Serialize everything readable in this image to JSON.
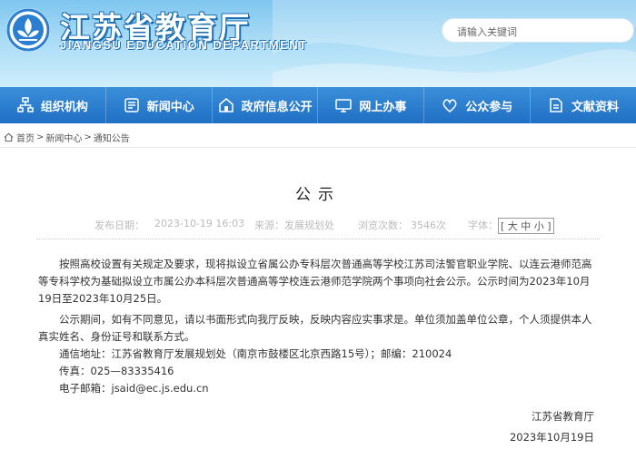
{
  "header": {
    "title": "江苏省教育厅",
    "subtitle": "JIANGSU EDUCATION DEPARTMENT",
    "search_placeholder": "请输入关键词"
  },
  "nav": {
    "items": [
      {
        "label": "组织机构",
        "icon": "org-chart-icon"
      },
      {
        "label": "新闻中心",
        "icon": "news-icon"
      },
      {
        "label": "政府信息公开",
        "icon": "info-disclosure-icon"
      },
      {
        "label": "网上办事",
        "icon": "online-service-icon"
      },
      {
        "label": "公众参与",
        "icon": "public-participation-icon"
      },
      {
        "label": "文献资料",
        "icon": "documents-icon"
      }
    ]
  },
  "breadcrumb": {
    "items": [
      "首页",
      "新闻中心",
      "通知公告"
    ],
    "separator": ">"
  },
  "article": {
    "title": "公示",
    "published_label": "发布日期：",
    "published_value": "2023-10-19 16:03",
    "source_label": "来源：",
    "source_value": "发展规划处",
    "views_label": "浏览次数：",
    "views_value": "3546次",
    "font_label": "字体：",
    "font_open": "[",
    "font_large": "大",
    "font_medium": "中",
    "font_small": "小",
    "font_close": "]",
    "para1": "按照高校设置有关规定及要求，现将拟设立省属公办专科层次普通高等学校江苏司法警官职业学院、以连云港师范高等专科学校为基础拟设立市属公办本科层次普通高等学校连云港师范学院两个事项向社会公示。公示时间为2023年10月19日至2023年10月25日。",
    "para2": "公示期间，如有不同意见，请以书面形式向我厅反映，反映内容应实事求是。单位须加盖单位公章，个人须提供本人真实姓名、身份证号和联系方式。",
    "address": "通信地址：江苏省教育厅发展规划处（南京市鼓楼区北京西路15号）；邮编：210024",
    "fax": "传真：025—83335416",
    "email": "电子邮箱：jsaid@ec.js.edu.cn",
    "signer": "江苏省教育厅",
    "sign_date": "2023年10月19日"
  },
  "colors": {
    "nav_bg": "#2a7fd0",
    "banner_light": "#cfeefc",
    "title_stroke": "#1f6fb3"
  }
}
